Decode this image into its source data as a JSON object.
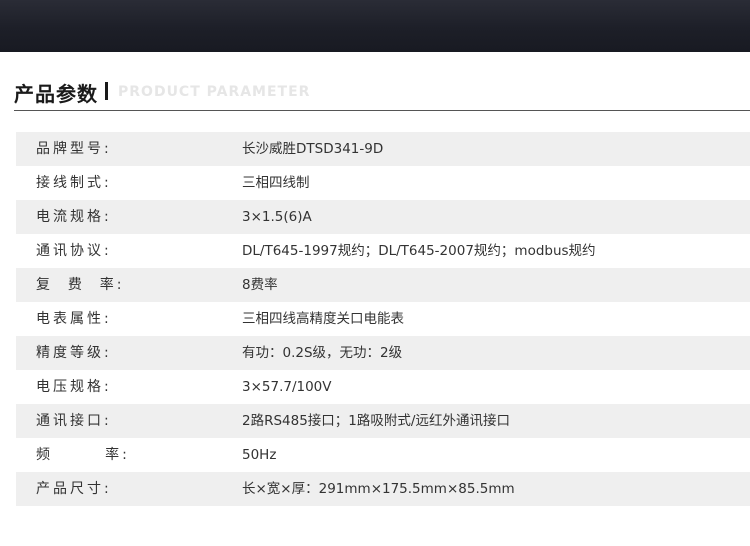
{
  "header": {
    "title": "产品参数",
    "subtitle": "PRODUCT PARAMETER"
  },
  "params": [
    {
      "label": "品牌型号:",
      "value": "长沙威胜DTSD341-9D"
    },
    {
      "label": "接线制式:",
      "value": "三相四线制"
    },
    {
      "label": "电流规格:",
      "value": "3×1.5(6)A"
    },
    {
      "label": "通讯协议:",
      "value": "DL/T645-1997规约；DL/T645-2007规约；modbus规约"
    },
    {
      "label": "复  费  率:",
      "value": "8费率"
    },
    {
      "label": "电表属性:",
      "value": "三相四线高精度关口电能表"
    },
    {
      "label": "精度等级:",
      "value": "有功：0.2S级，无功：2级"
    },
    {
      "label": "电压规格:",
      "value": "3×57.7/100V"
    },
    {
      "label": "通讯接口:",
      "value": "2路RS485接口；1路吸附式/远红外通讯接口"
    },
    {
      "label": "频       率:",
      "value": "50Hz"
    },
    {
      "label": "产品尺寸:",
      "value": "长×宽×厚：291mm×175.5mm×85.5mm"
    }
  ]
}
